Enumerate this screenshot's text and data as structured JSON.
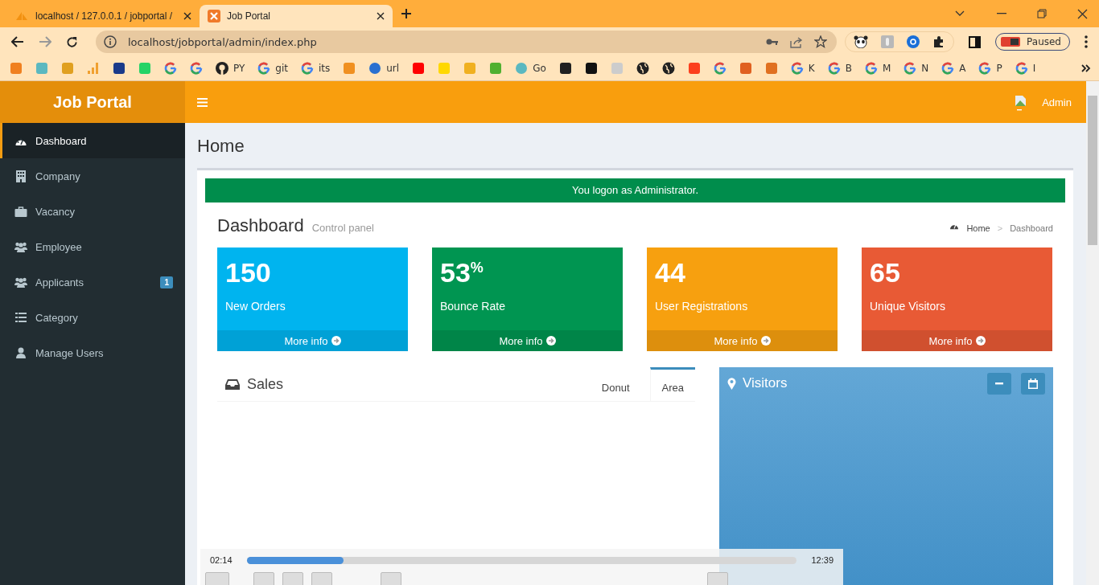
{
  "browser": {
    "tabs": [
      {
        "title": "localhost / 127.0.0.1 / jobportal /",
        "kind": "pma",
        "selected": false
      },
      {
        "title": "Job Portal",
        "kind": "xampp",
        "selected": true
      }
    ],
    "address": "localhost/jobportal/admin/index.php",
    "profile": "Paused",
    "bookmarks": [
      {
        "kind": "site",
        "color": "#f08020"
      },
      {
        "kind": "site",
        "color": "#5bb8c0"
      },
      {
        "kind": "site",
        "color": "#e0a020"
      },
      {
        "kind": "bars",
        "color": "#f0a030"
      },
      {
        "kind": "site",
        "color": "#1a3a8a"
      },
      {
        "kind": "site",
        "color": "#25d366"
      },
      {
        "kind": "google"
      },
      {
        "kind": "google"
      },
      {
        "kind": "github",
        "label": "PY"
      },
      {
        "kind": "google",
        "label": "git"
      },
      {
        "kind": "google",
        "label": "its"
      },
      {
        "kind": "site",
        "color": "#f09020"
      },
      {
        "kind": "site",
        "color": "#2a70d0",
        "label": "url"
      },
      {
        "kind": "site",
        "color": "#ff0000"
      },
      {
        "kind": "site",
        "color": "#ffd800"
      },
      {
        "kind": "site",
        "color": "#f0b020"
      },
      {
        "kind": "site",
        "color": "#50b030"
      },
      {
        "kind": "site",
        "color": "#5bb8c0",
        "label": "Go"
      },
      {
        "kind": "site",
        "color": "#202020"
      },
      {
        "kind": "site",
        "color": "#111111"
      },
      {
        "kind": "site",
        "color": "#cccccc"
      },
      {
        "kind": "globe"
      },
      {
        "kind": "globe"
      },
      {
        "kind": "site",
        "color": "#fc3f1d"
      },
      {
        "kind": "google"
      },
      {
        "kind": "site",
        "color": "#e06020"
      },
      {
        "kind": "site",
        "color": "#e07020"
      },
      {
        "kind": "google",
        "label": "K"
      },
      {
        "kind": "google",
        "label": "B"
      },
      {
        "kind": "google",
        "label": "M"
      },
      {
        "kind": "google",
        "label": "N"
      },
      {
        "kind": "google",
        "label": "A"
      },
      {
        "kind": "google",
        "label": "P"
      },
      {
        "kind": "google",
        "label": "I"
      }
    ]
  },
  "app": {
    "logo": "Job Portal",
    "user": "Admin",
    "sidebar": [
      {
        "label": "Dashboard",
        "kind": "dashboard",
        "selected": true
      },
      {
        "label": "Company",
        "kind": "building",
        "selected": false
      },
      {
        "label": "Vacancy",
        "kind": "briefcase",
        "selected": false
      },
      {
        "label": "Employee",
        "kind": "users",
        "selected": false
      },
      {
        "label": "Applicants",
        "kind": "users",
        "selected": false,
        "badge": "1"
      },
      {
        "label": "Category",
        "kind": "list",
        "selected": false
      },
      {
        "label": "Manage Users",
        "kind": "user",
        "selected": false
      }
    ],
    "page_title": "Home",
    "alert": "You logon as Administrator.",
    "section_title": "Dashboard",
    "section_subtitle": "Control panel",
    "breadcrumb": [
      "Home",
      "Dashboard"
    ],
    "breadcrumb_separator": ">",
    "stats": [
      {
        "value": "150",
        "label": "New Orders",
        "link": "More info",
        "color": "#00b4ef"
      },
      {
        "value": "53",
        "unit": "%",
        "label": "Bounce Rate",
        "link": "More info",
        "color": "#009551"
      },
      {
        "value": "44",
        "label": "User Registrations",
        "link": "More info",
        "color": "#f7a00f"
      },
      {
        "value": "65",
        "label": "Unique Visitors",
        "link": "More info",
        "color": "#e85a35"
      }
    ],
    "sales": {
      "title": "Sales",
      "tabs": [
        {
          "label": "Donut",
          "selected": false
        },
        {
          "label": "Area",
          "selected": true
        }
      ]
    },
    "visitors": {
      "title": "Visitors"
    }
  },
  "player": {
    "elapsed": "02:14",
    "total": "12:39",
    "level": 0.176
  }
}
